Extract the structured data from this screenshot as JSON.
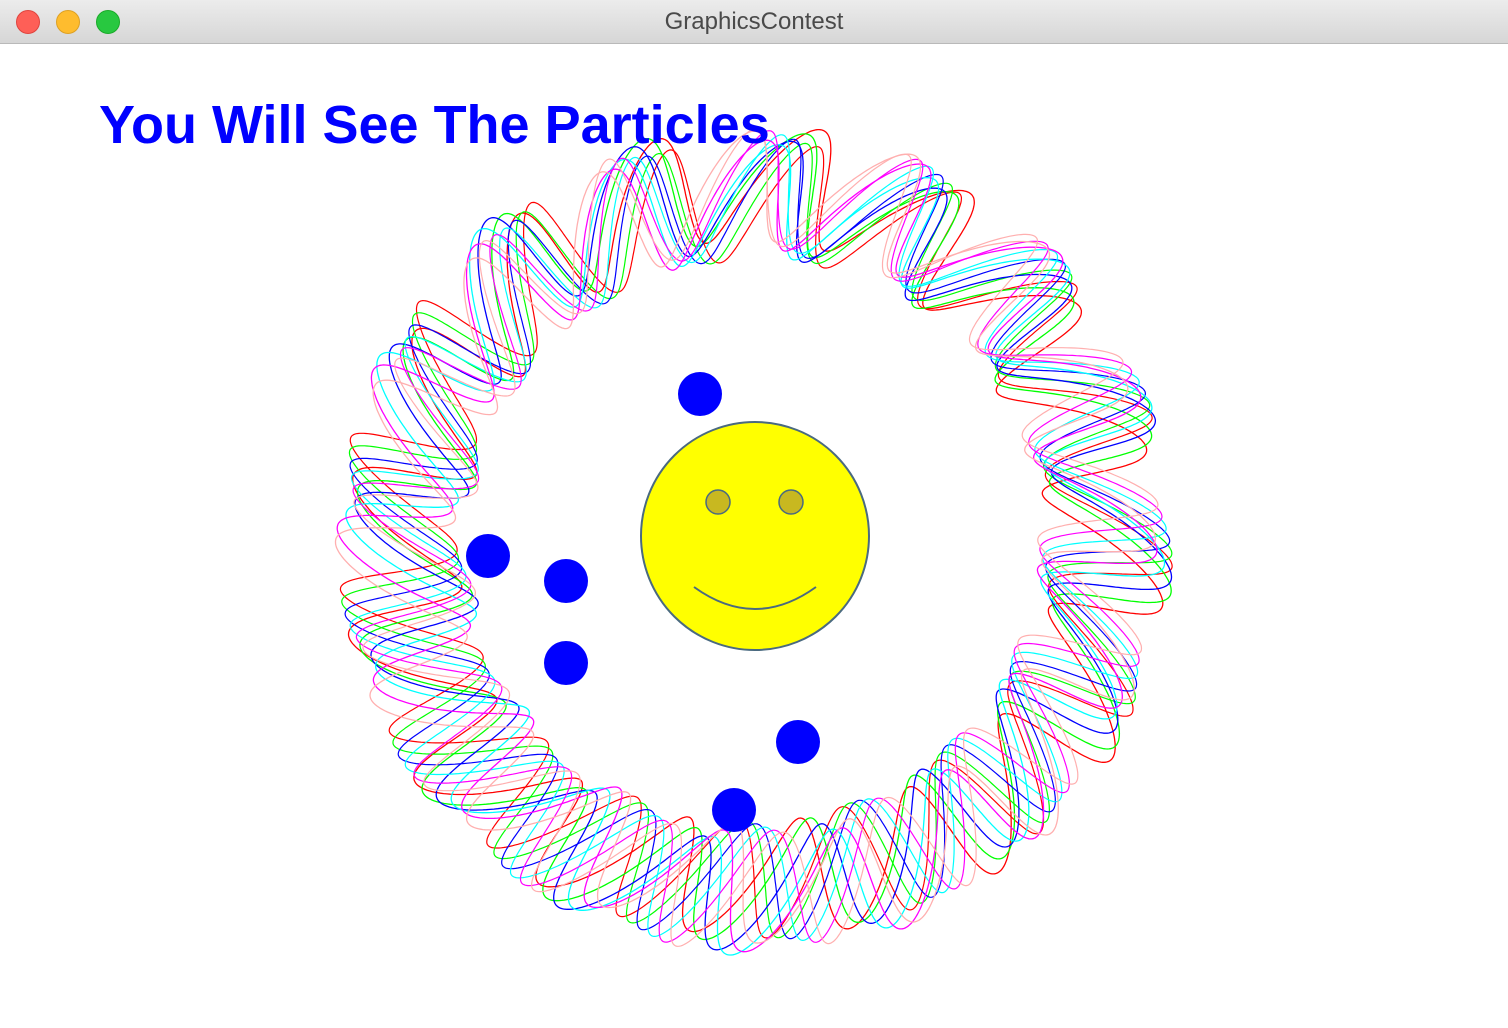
{
  "window": {
    "title": "GraphicsContest"
  },
  "scene": {
    "headline": "You Will See The Particles",
    "headline_color": "#0000ff",
    "spirograph_colors": [
      "#ff0000",
      "#00ff00",
      "#0000ff",
      "#00ffff",
      "#ff00ff",
      "#ffafaf"
    ],
    "particle_color": "#0000ff",
    "particle_count": 6,
    "smiley": {
      "face_color": "#ffff00",
      "outline_color": "#4a6a80",
      "eye_color": "#c8b820"
    }
  }
}
